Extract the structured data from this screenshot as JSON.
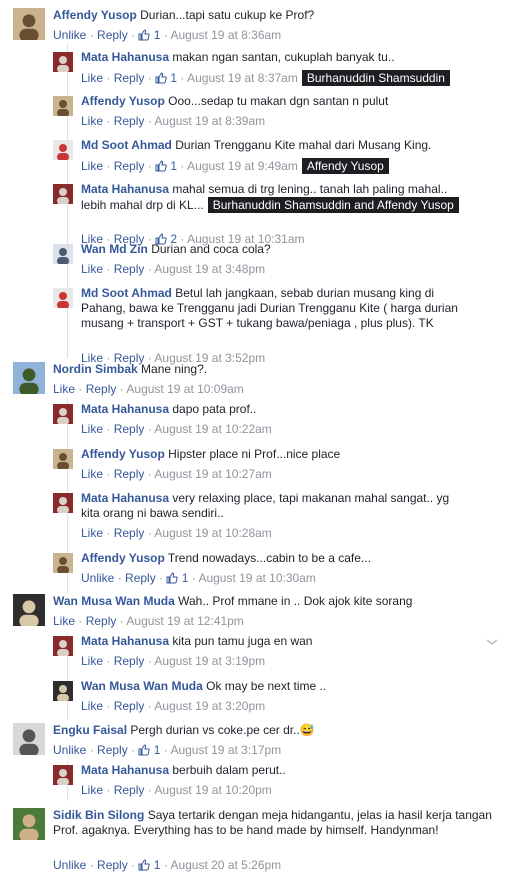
{
  "labels": {
    "like": "Like",
    "unlike": "Unlike",
    "reply": "Reply",
    "dot": "·"
  },
  "comments": [
    {
      "name": "Affendy Yusop",
      "text": "Durian...tapi satu cukup ke Prof?",
      "like": "Unlike",
      "likes": "1",
      "time": "August 19 at 8:36am",
      "tag": ""
    },
    {
      "name": "Mata Hahanusa",
      "text": "makan ngan santan, cukuplah banyak tu..",
      "like": "Like",
      "likes": "1",
      "time": "August 19 at 8:37am",
      "tag": "Burhanuddin Shamsuddin"
    },
    {
      "name": "Affendy Yusop",
      "text": "Ooo...sedap tu makan dgn santan n pulut",
      "like": "Like",
      "likes": "",
      "time": "August 19 at 8:39am",
      "tag": ""
    },
    {
      "name": "Md Soot Ahmad",
      "text": "Durian Trengganu Kite mahal dari Musang King.",
      "like": "Like",
      "likes": "1",
      "time": "August 19 at 9:49am",
      "tag": "Affendy Yusop"
    },
    {
      "name": "Mata Hahanusa",
      "text": "mahal semua di trg lening.. tanah lah paling mahal.. lebih mahal drp di KL...",
      "like": "Like",
      "likes": "2",
      "time": "August 19 at 10:31am",
      "tag": "Burhanuddin Shamsuddin and Affendy Yusop"
    },
    {
      "name": "Wan Md Zin",
      "text": "Durian and coca cola?",
      "like": "Like",
      "likes": "",
      "time": "August 19 at 3:48pm",
      "tag": ""
    },
    {
      "name": "Md Soot Ahmad",
      "text": "Betul lah jangkaan, sebab durian musang king di Pahang, bawa ke Trengganu jadi Durian Trengganu Kite ( harga durian musang + transport + GST + tukang bawa/peniaga , plus plus). TK",
      "like": "Like",
      "likes": "",
      "time": "August 19 at 3:52pm",
      "tag": ""
    },
    {
      "name": "Nordin Simbak",
      "text": "Mane ning?.",
      "like": "Like",
      "likes": "",
      "time": "August 19 at 10:09am",
      "tag": ""
    },
    {
      "name": "Mata Hahanusa",
      "text": "dapo pata prof..",
      "like": "Like",
      "likes": "",
      "time": "August 19 at 10:22am",
      "tag": ""
    },
    {
      "name": "Affendy Yusop",
      "text": "Hipster place ni Prof...nice place",
      "like": "Like",
      "likes": "",
      "time": "August 19 at 10:27am",
      "tag": ""
    },
    {
      "name": "Mata Hahanusa",
      "text": "very relaxing place, tapi makanan mahal sangat.. yg kita orang ni bawa sendiri..",
      "like": "Like",
      "likes": "",
      "time": "August 19 at 10:28am",
      "tag": ""
    },
    {
      "name": "Affendy Yusop",
      "text": "Trend nowadays...cabin to be a cafe...",
      "like": "Unlike",
      "likes": "1",
      "time": "August 19 at 10:30am",
      "tag": ""
    },
    {
      "name": "Wan Musa Wan Muda",
      "text": "Wah.. Prof mmane in .. Dok ajok kite sorang",
      "like": "Like",
      "likes": "",
      "time": "August 19 at 12:41pm",
      "tag": ""
    },
    {
      "name": "Mata Hahanusa",
      "text": "kita pun tamu juga en wan",
      "like": "Like",
      "likes": "",
      "time": "August 19 at 3:19pm",
      "tag": ""
    },
    {
      "name": "Wan Musa Wan Muda",
      "text": "Ok may be next time ..",
      "like": "Like",
      "likes": "",
      "time": "August 19 at 3:20pm",
      "tag": ""
    },
    {
      "name": "Engku Faisal",
      "text": "Pergh durian vs coke.pe cer dr..",
      "like": "Unlike",
      "likes": "1",
      "time": "August 19 at 3:17pm",
      "tag": "",
      "emoji": "😅"
    },
    {
      "name": "Mata Hahanusa",
      "text": "berbuih dalam perut..",
      "like": "Like",
      "likes": "",
      "time": "August 19 at 10:20pm",
      "tag": ""
    },
    {
      "name": "Sidik Bin Silong",
      "text": "Saya tertarik dengan meja hidangantu, jelas ia hasil kerja tangan Prof. agaknya. Everything has to be hand made by himself. Handynman!",
      "like": "Unlike",
      "likes": "1",
      "time": "August 20 at 5:26pm",
      "tag": ""
    }
  ]
}
